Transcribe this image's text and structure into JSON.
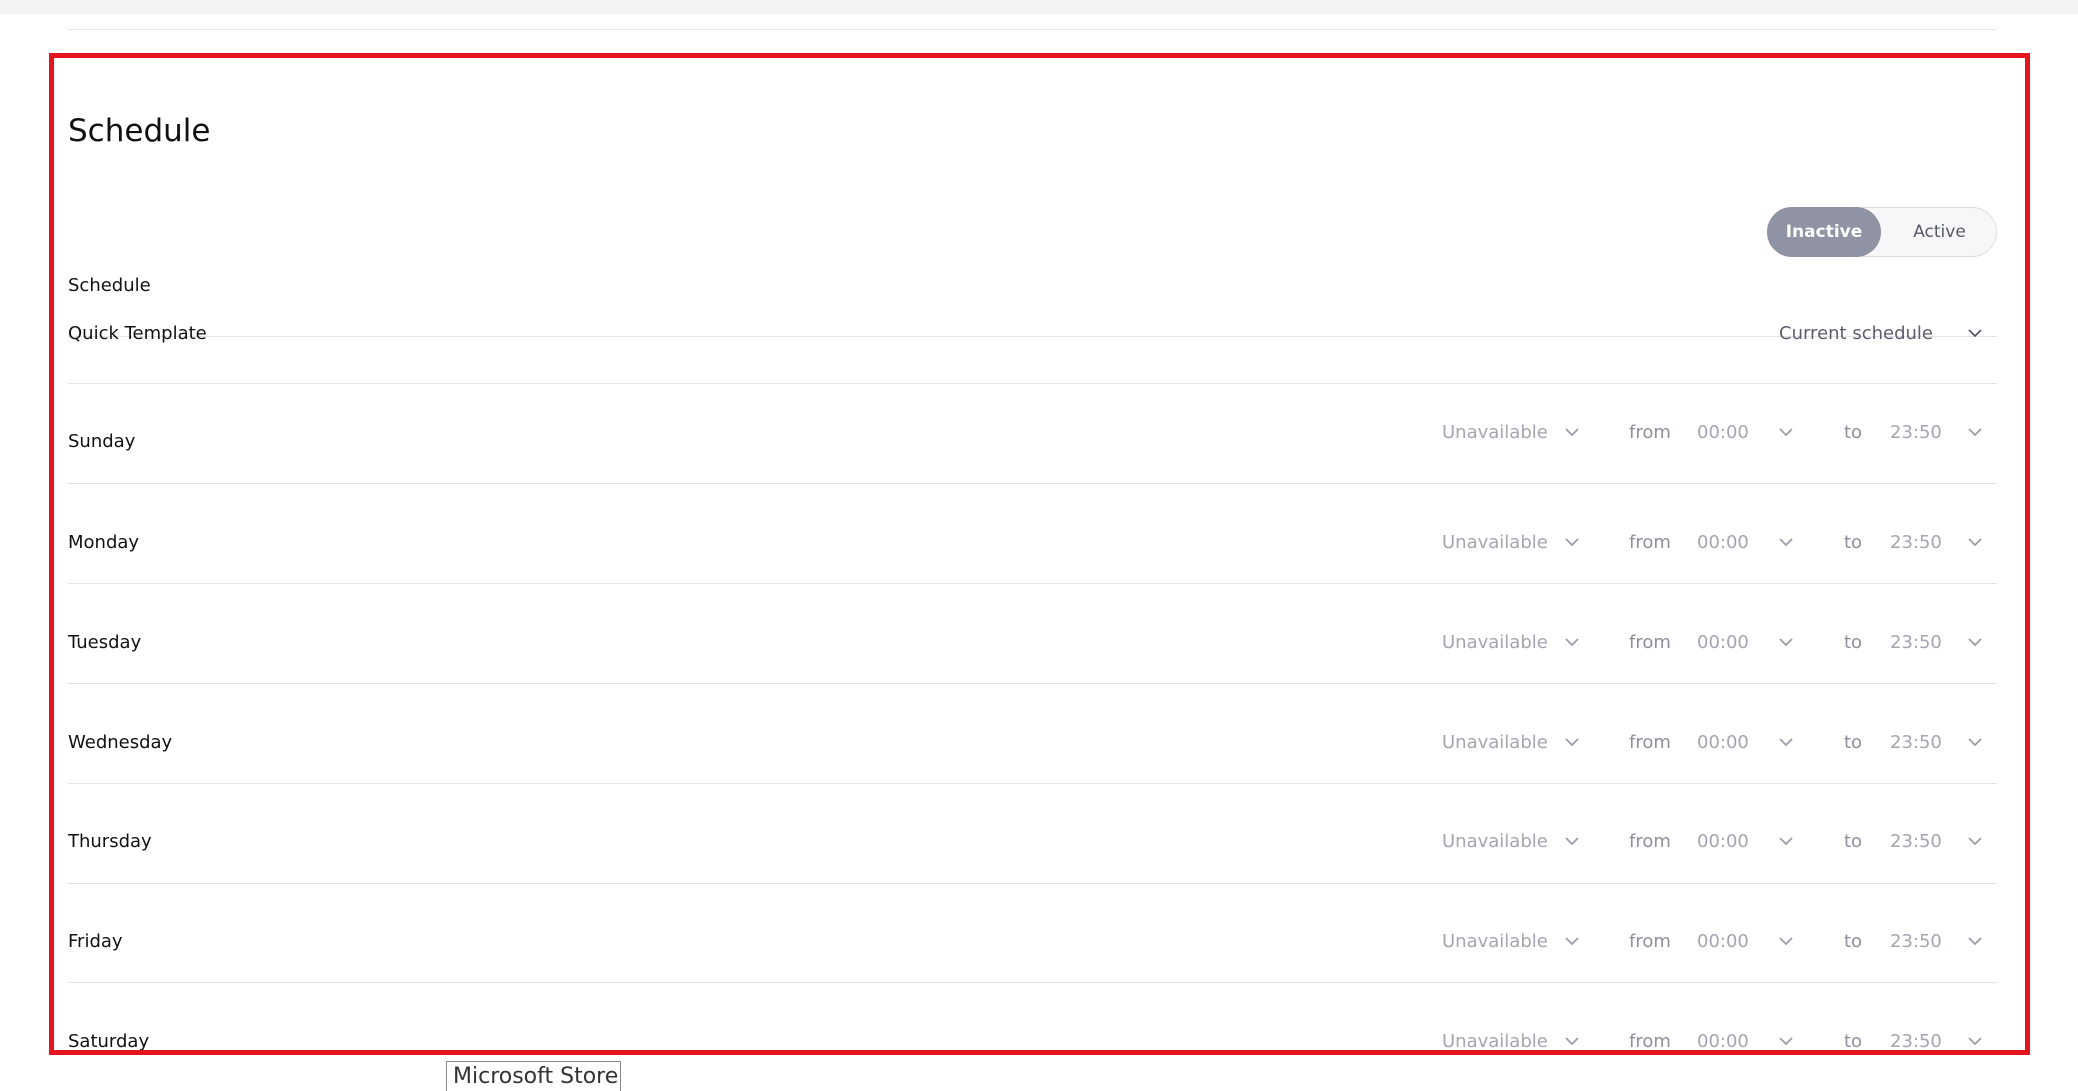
{
  "section": {
    "title": "Schedule"
  },
  "schedule_toggle": {
    "label": "Schedule",
    "options": [
      "Inactive",
      "Active"
    ],
    "selected": "Inactive"
  },
  "quick_template": {
    "label": "Quick Template",
    "value": "Current schedule"
  },
  "days": [
    {
      "name": "Sunday",
      "availability": "Unavailable",
      "from_label": "from",
      "from": "00:00",
      "to_label": "to",
      "to": "23:50"
    },
    {
      "name": "Monday",
      "availability": "Unavailable",
      "from_label": "from",
      "from": "00:00",
      "to_label": "to",
      "to": "23:50"
    },
    {
      "name": "Tuesday",
      "availability": "Unavailable",
      "from_label": "from",
      "from": "00:00",
      "to_label": "to",
      "to": "23:50"
    },
    {
      "name": "Wednesday",
      "availability": "Unavailable",
      "from_label": "from",
      "from": "00:00",
      "to_label": "to",
      "to": "23:50"
    },
    {
      "name": "Thursday",
      "availability": "Unavailable",
      "from_label": "from",
      "from": "00:00",
      "to_label": "to",
      "to": "23:50"
    },
    {
      "name": "Friday",
      "availability": "Unavailable",
      "from_label": "from",
      "from": "00:00",
      "to_label": "to",
      "to": "23:50"
    },
    {
      "name": "Saturday",
      "availability": "Unavailable",
      "from_label": "from",
      "from": "00:00",
      "to_label": "to",
      "to": "23:50"
    }
  ],
  "tooltip": {
    "text": "Microsoft Store"
  },
  "colors": {
    "highlight": "#e3141b",
    "toggle_selected": "#8f93a3"
  }
}
